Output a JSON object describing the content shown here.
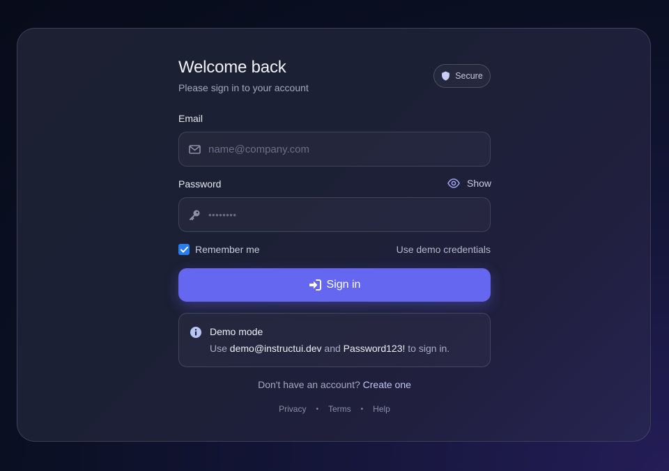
{
  "header": {
    "title": "Welcome back",
    "subtitle": "Please sign in to your account",
    "badge": "Secure"
  },
  "email": {
    "label": "Email",
    "placeholder": "name@company.com",
    "value": ""
  },
  "password": {
    "label": "Password",
    "toggle_label": "Show",
    "value": "••••••••"
  },
  "options": {
    "remember_label": "Remember me",
    "remember_checked": true,
    "demo_link": "Use demo credentials"
  },
  "submit": {
    "label": "Sign in"
  },
  "notice": {
    "title": "Demo mode",
    "prefix": "Use",
    "email": "demo@instructui.dev",
    "and": "and",
    "password": "Password123!",
    "suffix": "to sign in."
  },
  "signup": {
    "prompt": "Don't have an account?",
    "link": "Create one"
  },
  "footer": {
    "links": [
      "Privacy",
      "Terms",
      "Help"
    ],
    "separator": "•"
  },
  "colors": {
    "accent": "#6567f0",
    "checkbox": "#2a7df0",
    "link": "#c3c6f7"
  },
  "icons": {
    "badge": "shield-icon",
    "email": "envelope-icon",
    "password": "key-icon",
    "toggle": "eye-icon",
    "submit": "sign-in-icon",
    "notice": "info-icon"
  }
}
